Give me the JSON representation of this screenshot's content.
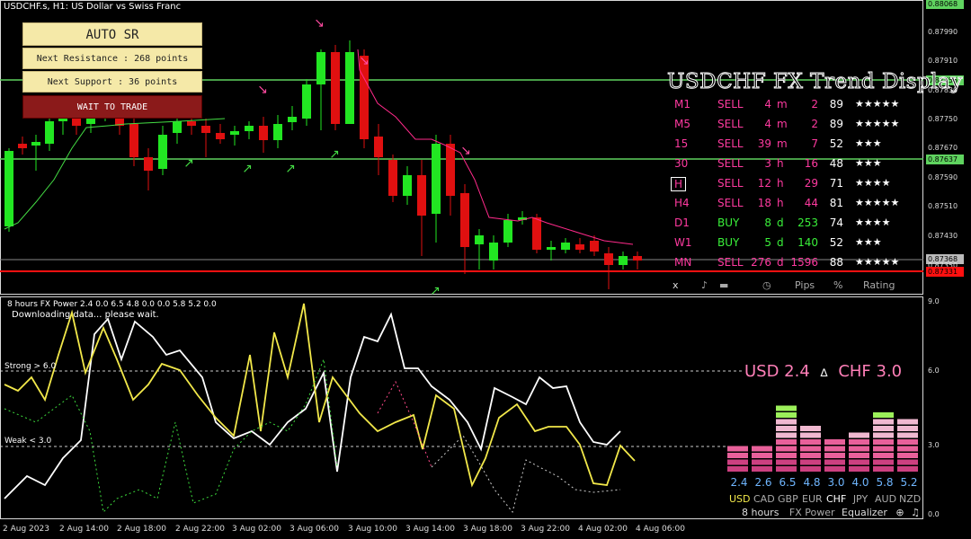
{
  "chart_header": "USDCHF.s, H1:  US Dollar vs Swiss Franc",
  "sr_panel": {
    "auto_label": "AUTO SR",
    "resistance_label": "Next Resistance : 268 points",
    "support_label": "Next Support : 36 points",
    "action_label": "WAIT TO TRADE"
  },
  "price_axis": {
    "ticks": [
      "0.87990",
      "0.87910",
      "0.87830",
      "0.87750",
      "0.87670",
      "0.87590",
      "0.87510",
      "0.87430",
      "0.87350"
    ],
    "top_label": "0.88068",
    "level_high": "0.87855",
    "level_mid": "0.87637",
    "current_price": "0.87368",
    "low_box": "0.87331"
  },
  "trend_display": {
    "title": "USDCHF FX Trend Display",
    "rows": [
      {
        "tf": "M1",
        "dir": "SELL",
        "num": "4",
        "unit": "m",
        "pips": "2",
        "pct": "89",
        "stars": "★★★★★"
      },
      {
        "tf": "M5",
        "dir": "SELL",
        "num": "4",
        "unit": "m",
        "pips": "2",
        "pct": "89",
        "stars": "★★★★★"
      },
      {
        "tf": "15",
        "dir": "SELL",
        "num": "39",
        "unit": "m",
        "pips": "7",
        "pct": "52",
        "stars": "★★★"
      },
      {
        "tf": "30",
        "dir": "SELL",
        "num": "3",
        "unit": "h",
        "pips": "16",
        "pct": "48",
        "stars": "★★★"
      },
      {
        "tf": "H",
        "dir": "SELL",
        "num": "12",
        "unit": "h",
        "pips": "29",
        "pct": "71",
        "stars": "★★★★"
      },
      {
        "tf": "H4",
        "dir": "SELL",
        "num": "18",
        "unit": "h",
        "pips": "44",
        "pct": "81",
        "stars": "★★★★★"
      },
      {
        "tf": "D1",
        "dir": "BUY",
        "num": "8",
        "unit": "d",
        "pips": "253",
        "pct": "74",
        "stars": "★★★★"
      },
      {
        "tf": "W1",
        "dir": "BUY",
        "num": "5",
        "unit": "d",
        "pips": "140",
        "pct": "52",
        "stars": "★★★"
      },
      {
        "tf": "MN",
        "dir": "SELL",
        "num": "276",
        "unit": "d",
        "pips": "1596",
        "pct": "88",
        "stars": "★★★★★"
      }
    ],
    "footer": {
      "close": "x",
      "pips": "Pips",
      "pct": "%",
      "rating": "Rating"
    }
  },
  "oscillator": {
    "header": "8 hours FX Power 2.4 0.0 6.5 4.8 0.0 0.0 5.8 5.2 0.0",
    "status": "Downloading data... please wait.",
    "strong_label": "Strong > 6.0",
    "weak_label": "Weak < 3.0",
    "axis": [
      "9.0",
      "6.0",
      "3.0",
      "0.0"
    ],
    "pair_left": "USD 2.4",
    "pair_right": "CHF 3.0",
    "pair_sep": "∆"
  },
  "equalizer": {
    "values": [
      "2.4",
      "2.6",
      "6.5",
      "4.8",
      "3.0",
      "4.0",
      "5.8",
      "5.2"
    ],
    "currencies": [
      "USD",
      "CAD",
      "GBP",
      "EUR",
      "CHF",
      "JPY",
      "AUD",
      "NZD"
    ],
    "footer": {
      "period": "8 hours",
      "name": "FX Power",
      "eq": "Equalizer"
    }
  },
  "time_axis": [
    "2 Aug 2023",
    "2 Aug 14:00",
    "2 Aug 18:00",
    "2 Aug 22:00",
    "3 Aug 02:00",
    "3 Aug 06:00",
    "3 Aug 10:00",
    "3 Aug 14:00",
    "3 Aug 18:00",
    "3 Aug 22:00",
    "4 Aug 02:00",
    "4 Aug 06:00"
  ],
  "colors": {
    "bull": "#22e622",
    "bear": "#e01010",
    "sell": "#ff3aa0",
    "buy": "#3af03a",
    "tf": "#ff3aa0",
    "level": "#5fd35f",
    "red_line": "#ff1010",
    "pink_line": "#ff2a8a",
    "green_line": "#44dd44",
    "yellow": "#f2e84a",
    "white": "#ffffff",
    "star": "#ffffff"
  }
}
